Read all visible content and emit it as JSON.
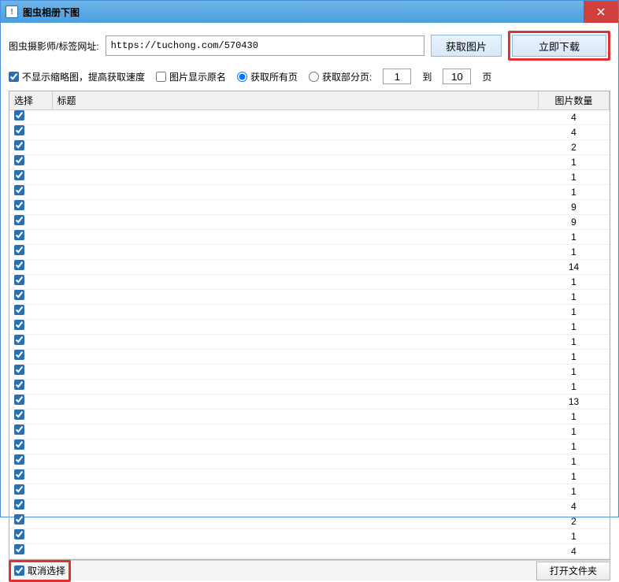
{
  "window": {
    "title": "图虫相册下图"
  },
  "urlLabel": "图虫摄影师/标签网址:",
  "urlValue": "https://tuchong.com/570430",
  "fetchBtn": "获取图片",
  "downloadBtn": "立即下载",
  "options": {
    "noThumb": "不显示缩略图，提高获取速度",
    "showOrig": "图片显示原名",
    "allPages": "获取所有页",
    "partPages": "获取部分页:",
    "fromVal": "1",
    "toLabel": "到",
    "toVal": "10",
    "pageUnit": "页"
  },
  "columns": {
    "select": "选择",
    "title": "标题",
    "count": "图片数量"
  },
  "rows": [
    {
      "c": 4
    },
    {
      "c": 4
    },
    {
      "c": 2
    },
    {
      "c": 1
    },
    {
      "c": 1
    },
    {
      "c": 1
    },
    {
      "c": 9
    },
    {
      "c": 9
    },
    {
      "c": 1
    },
    {
      "c": 1
    },
    {
      "c": 14
    },
    {
      "c": 1
    },
    {
      "c": 1
    },
    {
      "c": 1
    },
    {
      "c": 1
    },
    {
      "c": 1
    },
    {
      "c": 1
    },
    {
      "c": 1
    },
    {
      "c": 1
    },
    {
      "c": 13
    },
    {
      "c": 1
    },
    {
      "c": 1
    },
    {
      "c": 1
    },
    {
      "c": 1
    },
    {
      "c": 1
    },
    {
      "c": 1
    },
    {
      "c": 4
    },
    {
      "c": 2
    },
    {
      "c": 1
    },
    {
      "c": 4
    }
  ],
  "deselectAll": "取消选择",
  "openFolder": "打开文件夹"
}
